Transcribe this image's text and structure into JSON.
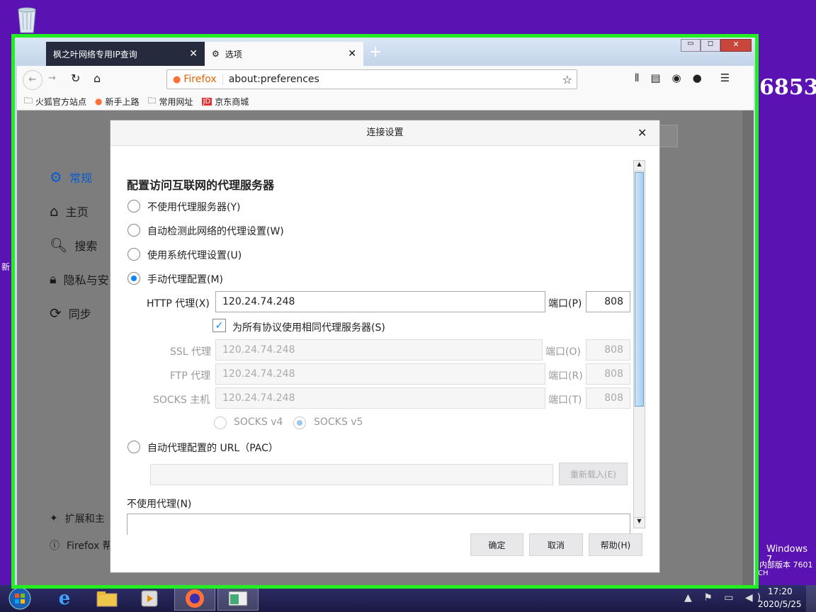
{
  "desktop": {
    "bg_text": "6853",
    "side_label": "新",
    "win_label": "Windows 7",
    "win_build": "内部版本 7601"
  },
  "taskbar": {
    "time": "17:20",
    "date": "2020/5/25",
    "lang": "CH"
  },
  "browser": {
    "tabs": [
      {
        "label": "枫之叶网络专用IP查询"
      },
      {
        "label": "选项"
      }
    ],
    "url_identity": "Firefox",
    "url": "about:preferences",
    "bookmarks": [
      "火狐官方站点",
      "新手上路",
      "常用网址",
      "京东商城"
    ]
  },
  "prefs_sidebar": {
    "items": [
      "常规",
      "主页",
      "搜索",
      "隐私与安",
      "同步"
    ],
    "bottom": [
      "扩展和主",
      "Firefox 帮"
    ]
  },
  "dialog": {
    "title": "连接设置",
    "heading": "配置访问互联网的代理服务器",
    "options": {
      "no_proxy": "不使用代理服务器(Y)",
      "auto_detect": "自动检测此网络的代理设置(W)",
      "system": "使用系统代理设置(U)",
      "manual": "手动代理配置(M)",
      "pac": "自动代理配置的 URL（PAC）"
    },
    "http_label": "HTTP 代理(X)",
    "http_value": "120.24.74.248",
    "port_label_p": "端口(P)",
    "http_port": "808",
    "same_for_all": "为所有协议使用相同代理服务器(S)",
    "ssl_label": "SSL 代理",
    "ssl_value": "120.24.74.248",
    "port_label_o": "端口(O)",
    "ssl_port": "808",
    "ftp_label": "FTP 代理",
    "ftp_value": "120.24.74.248",
    "port_label_r": "端口(R)",
    "ftp_port": "808",
    "socks_label": "SOCKS 主机",
    "socks_value": "120.24.74.248",
    "port_label_t": "端口(T)",
    "socks_port": "808",
    "socks_v4": "SOCKS v4",
    "socks_v5": "SOCKS v5",
    "reload": "重新载入(E)",
    "no_proxy_for": "不使用代理(N)",
    "ok": "确定",
    "cancel": "取消",
    "help": "帮助(H)"
  }
}
